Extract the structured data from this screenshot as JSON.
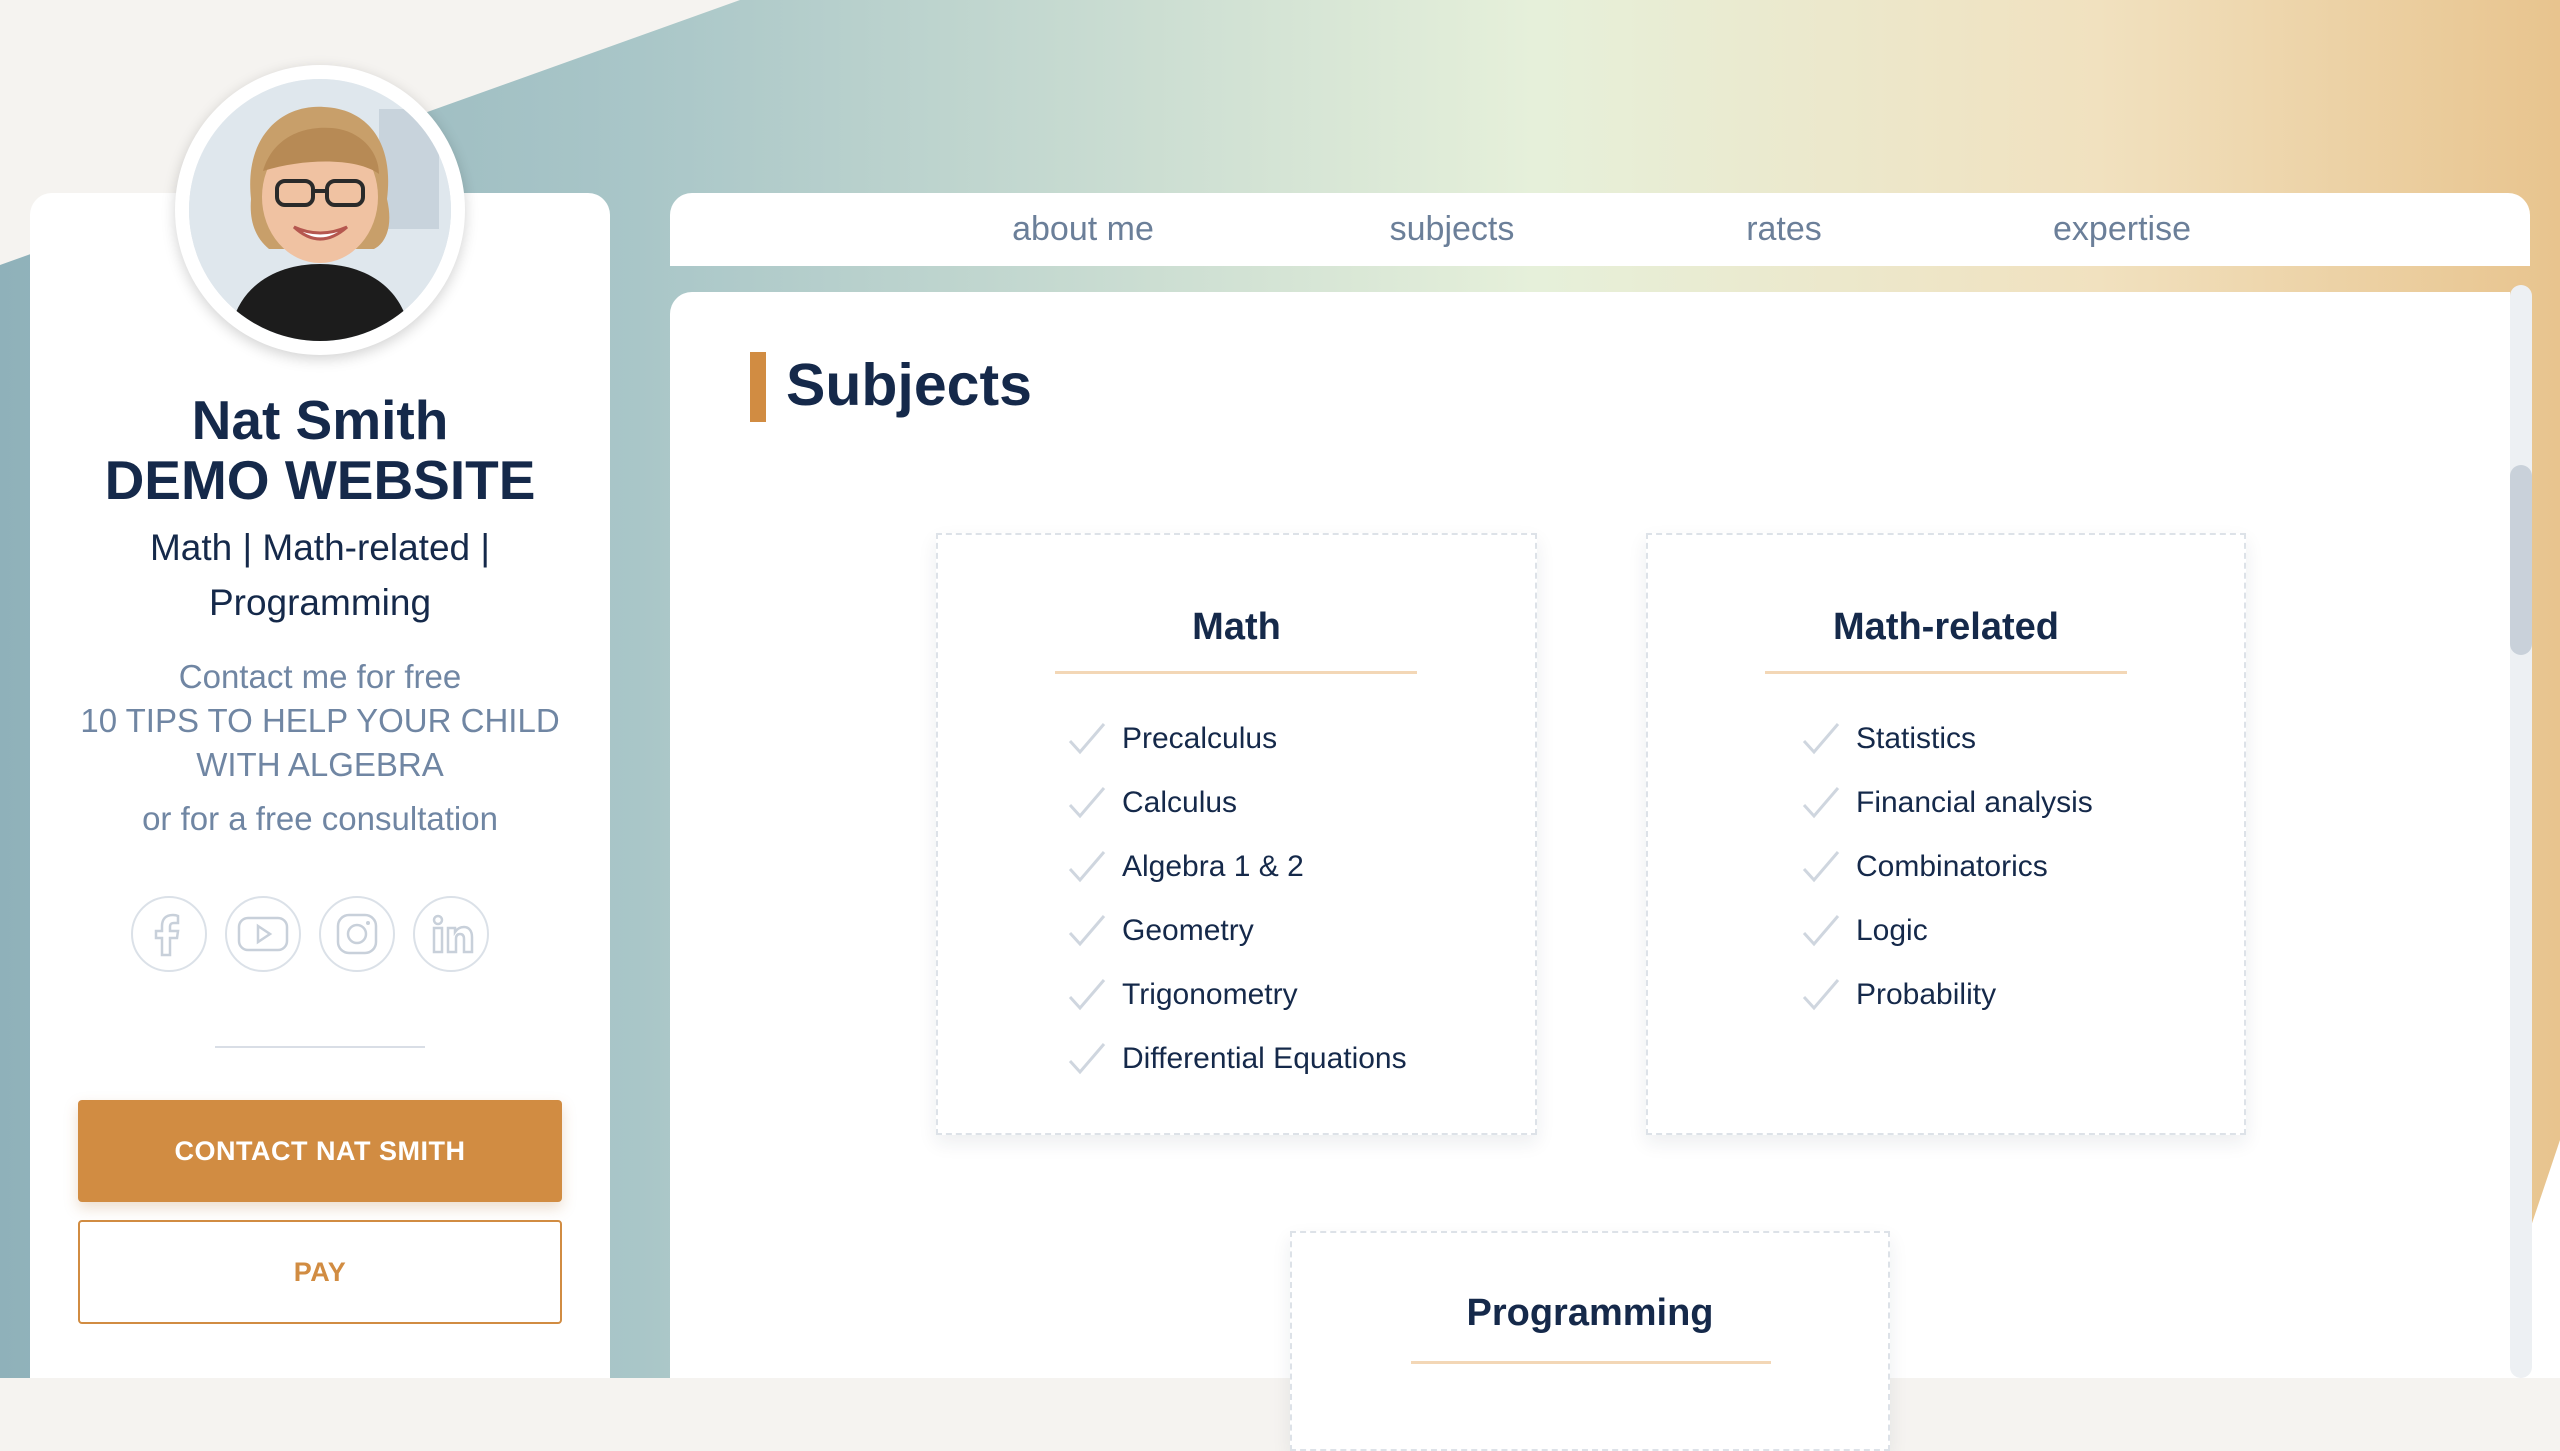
{
  "profile": {
    "name_line1": "Nat Smith",
    "name_line2": "DEMO WEBSITE",
    "subjects_line1": "Math | Math-related |",
    "subjects_line2": "Programming",
    "promo_free": "Contact me for free",
    "promo_tips": "10 TIPS TO HELP YOUR CHILD WITH ALGEBRA",
    "promo_consult": "or for a free consultation",
    "socials": [
      "facebook-icon",
      "youtube-icon",
      "instagram-icon",
      "linkedin-icon"
    ],
    "contact_button": "CONTACT NAT SMITH",
    "pay_button": "PAY"
  },
  "nav": {
    "items": [
      {
        "label": "about me"
      },
      {
        "label": "subjects"
      },
      {
        "label": "rates"
      },
      {
        "label": "expertise"
      }
    ]
  },
  "section": {
    "title": "Subjects",
    "cards": [
      {
        "title": "Math",
        "items": [
          "Precalculus",
          "Calculus",
          "Algebra 1 & 2",
          "Geometry",
          "Trigonometry",
          "Differential Equations"
        ]
      },
      {
        "title": "Math-related",
        "items": [
          "Statistics",
          "Financial analysis",
          "Combinatorics",
          "Logic",
          "Probability"
        ]
      },
      {
        "title": "Programming",
        "items": []
      }
    ]
  },
  "colors": {
    "accent": "#d18c42",
    "navy": "#15294a",
    "muted": "#7086a3"
  }
}
